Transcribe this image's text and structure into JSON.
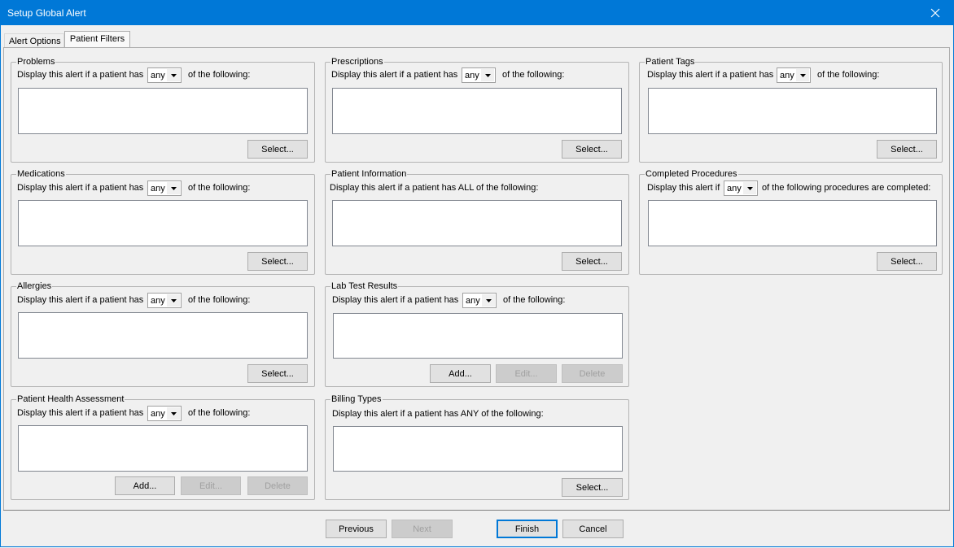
{
  "window": {
    "title": "Setup Global Alert"
  },
  "tabs": {
    "alert_options": "Alert Options",
    "patient_filters": "Patient Filters"
  },
  "common": {
    "prefix": "Display this alert if a patient has",
    "suffix": "of the following:",
    "combo_value": "any"
  },
  "problems": {
    "title": "Problems",
    "select": "Select..."
  },
  "prescriptions": {
    "title": "Prescriptions",
    "select": "Select..."
  },
  "patient_tags": {
    "title": "Patient Tags",
    "select": "Select..."
  },
  "medications": {
    "title": "Medications",
    "select": "Select..."
  },
  "patient_information": {
    "title": "Patient Information",
    "prompt": "Display this alert if a patient has ALL of the following:",
    "select": "Select..."
  },
  "completed_procedures": {
    "title": "Completed Procedures",
    "prefix": "Display this alert if",
    "suffix": "of the following procedures are completed:",
    "select": "Select..."
  },
  "allergies": {
    "title": "Allergies",
    "select": "Select..."
  },
  "lab_test_results": {
    "title": "Lab Test Results",
    "add": "Add...",
    "edit": "Edit...",
    "delete": "Delete"
  },
  "patient_health_assessment": {
    "title": "Patient Health Assessment",
    "add": "Add...",
    "edit": "Edit...",
    "delete": "Delete"
  },
  "billing_types": {
    "title": "Billing Types",
    "prompt": "Display this alert if a patient has ANY of the following:",
    "select": "Select..."
  },
  "footer": {
    "previous": "Previous",
    "next": "Next",
    "finish": "Finish",
    "cancel": "Cancel"
  },
  "colors": {
    "titlebar": "#0078d7",
    "accent": "#0078d7"
  }
}
